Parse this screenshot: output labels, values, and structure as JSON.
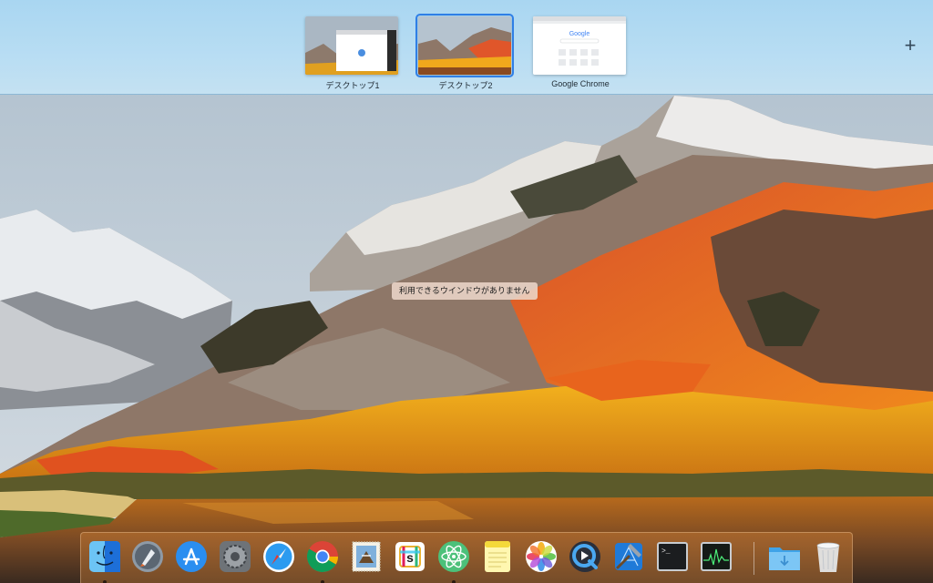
{
  "spaces_bar": {
    "spaces": [
      {
        "label": "デスクトップ1",
        "active": false
      },
      {
        "label": "デスクトップ2",
        "active": true
      },
      {
        "label": "Google Chrome",
        "active": false
      }
    ],
    "add_label": "+",
    "thumbnail_google_text": "Google"
  },
  "desktop": {
    "no_windows_message": "利用できるウインドウがありません"
  },
  "dock": {
    "apps": [
      {
        "icon": "finder-icon",
        "running": true
      },
      {
        "icon": "launchpad-icon",
        "running": false
      },
      {
        "icon": "app-store-icon",
        "running": false
      },
      {
        "icon": "system-preferences-icon",
        "running": false
      },
      {
        "icon": "safari-icon",
        "running": false
      },
      {
        "icon": "chrome-icon",
        "running": true
      },
      {
        "icon": "mail-stamp-icon",
        "running": false
      },
      {
        "icon": "slack-icon",
        "running": false
      },
      {
        "icon": "atom-icon",
        "running": true
      },
      {
        "icon": "notes-icon",
        "running": false
      },
      {
        "icon": "photos-icon",
        "running": false
      },
      {
        "icon": "quicktime-icon",
        "running": false
      },
      {
        "icon": "xcode-icon",
        "running": false
      },
      {
        "icon": "terminal-icon",
        "running": false
      },
      {
        "icon": "activity-monitor-icon",
        "running": false
      },
      {
        "icon": "downloads-folder-icon",
        "running": false
      },
      {
        "icon": "trash-icon",
        "running": false
      }
    ],
    "terminal_prompt": ">_"
  },
  "colors": {
    "active_space_outline": "#2f7fe6",
    "spaces_bar_bg": "#b8ddf3",
    "dock_tint": "#e18c3c"
  }
}
